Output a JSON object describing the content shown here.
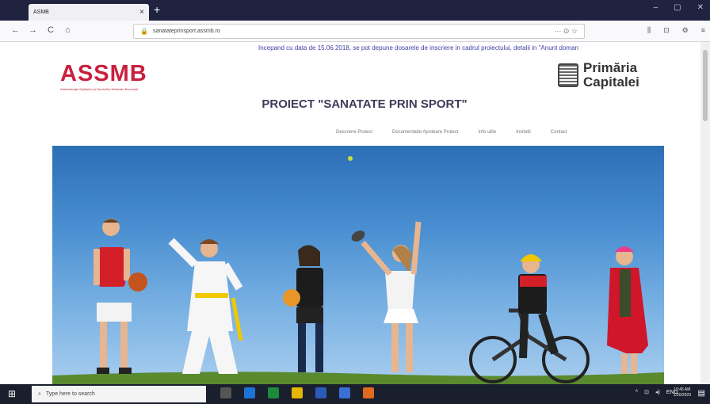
{
  "browser": {
    "tab_title": "ASMB",
    "tab_close": "×",
    "new_tab": "+",
    "window_controls": [
      "–",
      "▢",
      "✕"
    ],
    "nav": {
      "back": "←",
      "forward": "→",
      "reload": "C",
      "home": "⌂"
    },
    "url": "sanatateprinsport.assmb.ro",
    "url_right": "··· ⊙ ☆",
    "toolbar_right": [
      "⫼",
      "⊡",
      "⚙",
      "≡"
    ]
  },
  "page": {
    "marquee": "Incepand cu data de 15.06.2018, se pot depune dosarele de inscriere in cadrul proiectului, detalii in \"Anunt doman",
    "logo_left": "ASSMB",
    "logo_left_sub": "Administraţia Spitalelor şi Serviciilor Medicale Bucureşti",
    "logo_right_line1": "Primăria",
    "logo_right_line2": "Capitalei",
    "title": "PROIECT \"SANATATE PRIN SPORT\"",
    "menu": [
      "Descriere Proiect",
      "Documentatie Aprobare Proiect",
      "Info utile",
      "Invitatii",
      "Contact"
    ]
  },
  "taskbar": {
    "search_placeholder": "Type here to search",
    "time": "10:45 AM",
    "date": "1/30/2020",
    "lang": "ENG"
  },
  "colors": {
    "brand_red": "#c8203e",
    "marquee_blue": "#4040a8",
    "tabbar": "#202340"
  }
}
